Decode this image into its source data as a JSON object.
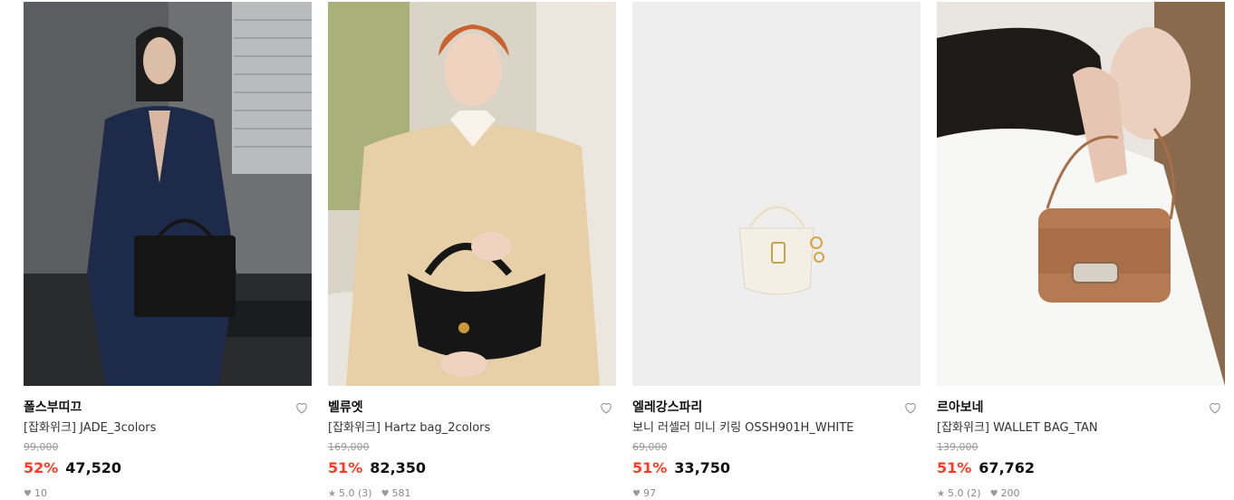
{
  "products": [
    {
      "brand": "폴스부띠끄",
      "title": "[잡화위크] JADE_3colors",
      "original_price": "99,000",
      "discount": "52%",
      "price": "47,520",
      "rating": "",
      "reviews": "",
      "likes": "10",
      "image_desc": "model-in-navy-suit-holding-black-tote"
    },
    {
      "brand": "벨류엣",
      "title": "[잡화위크] Hartz bag_2colors",
      "original_price": "169,000",
      "discount": "51%",
      "price": "82,350",
      "rating": "5.0",
      "reviews": "(3)",
      "likes": "581",
      "image_desc": "model-in-beige-coat-holding-black-bag"
    },
    {
      "brand": "엘레강스파리",
      "title": "보니 러셀러 미니 키링 OSSH901H_WHITE",
      "original_price": "69,000",
      "discount": "51%",
      "price": "33,750",
      "rating": "",
      "reviews": "",
      "likes": "97",
      "image_desc": "white-mini-bag-keyring-on-grey"
    },
    {
      "brand": "르아보네",
      "title": "[잡화위크] WALLET BAG_TAN",
      "original_price": "139,000",
      "discount": "51%",
      "price": "67,762",
      "rating": "5.0",
      "reviews": "(2)",
      "likes": "200",
      "image_desc": "model-with-tan-leather-wallet-bag"
    }
  ],
  "icons": {
    "heart": "heart-outline-icon",
    "star": "star-icon",
    "like": "heart-filled-icon"
  },
  "colors": {
    "discount": "#ff3b1f",
    "text": "#111111",
    "muted": "#9a9a9a"
  }
}
